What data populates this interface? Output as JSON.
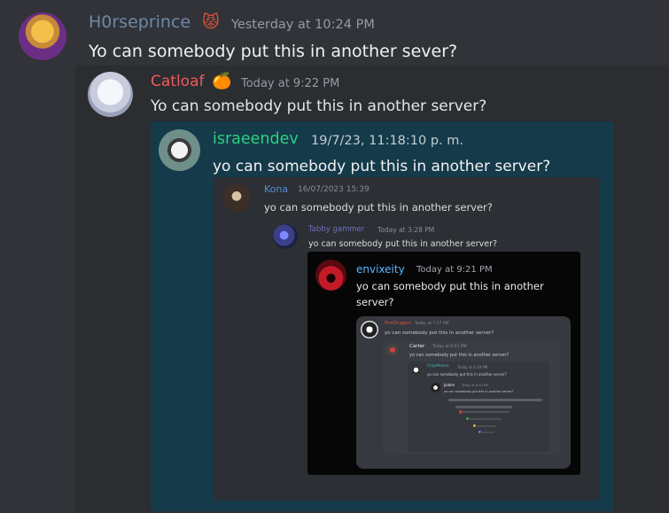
{
  "messages": [
    {
      "author": "H0rseprince",
      "badge_icon": "angry-fox-emoji-icon",
      "timestamp": "Yesterday at 10:24 PM",
      "content": "Yo can somebody put this in another sever?"
    },
    {
      "author": "Catloaf",
      "badge_icon": "tangerine-emoji-icon",
      "timestamp": "Today at 9:22 PM",
      "content": "Yo can somebody put this in another server?"
    },
    {
      "author": "israeendev",
      "timestamp": "19/7/23, 11:18:10 p. m.",
      "content": "yo can somebody put this in another server?"
    },
    {
      "author": "Kona",
      "timestamp": "16/07/2023 15:39",
      "content": "yo can somebody put this in another server?"
    },
    {
      "author": "Tabby gammer",
      "timestamp": "Today at 3:28 PM",
      "content": "yo can somebody put this in another server?"
    },
    {
      "author": "envixeity",
      "timestamp": "Today at 9:21 PM",
      "content_line1": "yo can somebody put this in another",
      "content_line2": "server?"
    },
    {
      "author": "FireDragon",
      "timestamp": "Today at 7:17 PM",
      "content": "yo can somebody put this in another server?"
    },
    {
      "author": "Carter",
      "timestamp": "Today at 6:51 PM",
      "content": "yo can somebody put this in another server?"
    },
    {
      "author": "ChipMoose",
      "timestamp": "Today at 6:28 PM",
      "content": "yo can somebody put this in another server?"
    },
    {
      "author": "Jaiden",
      "timestamp": "Today at 6:10 PM",
      "content": "yo can somebody put this in another server?"
    }
  ]
}
